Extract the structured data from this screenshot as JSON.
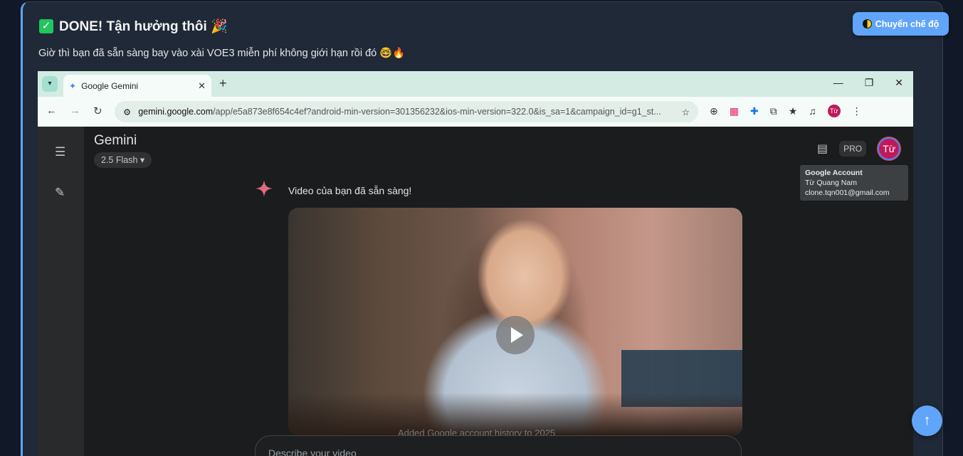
{
  "page": {
    "heading": "DONE! Tận hưởng thôi 🎉",
    "subtext": "Giờ thì bạn đã sẵn sàng bay vào xài VOE3 miễn phí không giới hạn rồi đó 🤓🔥",
    "mode_button": "Chuyển chế độ"
  },
  "browser": {
    "tab_title": "Google Gemini",
    "url_domain": "gemini.google.com",
    "url_path": "/app/e5a873e8f654c4ef?android-min-version=301356232&ios-min-version=322.0&is_sa=1&campaign_id=g1_st...",
    "profile_initials": "Từ"
  },
  "gemini": {
    "title": "Gemini",
    "model": "2.5 Flash",
    "pro_badge": "PRO",
    "avatar": "Từ",
    "tooltip": {
      "title": "Google Account",
      "name": "Từ Quang Nam",
      "email": "clone.tqn001@gmail.com"
    },
    "message": "Video của bạn đã sẵn sàng!",
    "video_caption": "Added Google account history to 2025",
    "prompt_placeholder": "Describe your video"
  },
  "colors": {
    "accent": "#60a5fa",
    "card": "#1f2937",
    "background": "#111827"
  }
}
